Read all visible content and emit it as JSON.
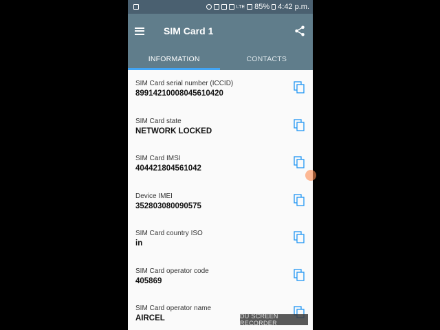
{
  "status_bar": {
    "battery": "85%",
    "time": "4:42 p.m.",
    "network_label": "LTE"
  },
  "toolbar": {
    "title": "SIM Card 1"
  },
  "tabs": [
    {
      "label": "INFORMATION",
      "active": true
    },
    {
      "label": "CONTACTS",
      "active": false
    }
  ],
  "items": [
    {
      "label": "SIM Card serial number (ICCID)",
      "value": "89914210008045610420"
    },
    {
      "label": "SIM Card state",
      "value": "NETWORK LOCKED"
    },
    {
      "label": "SIM Card IMSI",
      "value": "404421804561042"
    },
    {
      "label": "Device IMEI",
      "value": "352803080090575"
    },
    {
      "label": "SIM Card country ISO",
      "value": "in"
    },
    {
      "label": "SIM Card operator code",
      "value": "405869"
    },
    {
      "label": "SIM Card operator name",
      "value": "AIRCEL"
    }
  ],
  "watermark": "DU SCREEN RECORDER",
  "colors": {
    "toolbar": "#607d8b",
    "status_bar": "#4a6070",
    "tab_indicator": "#42a5f5",
    "copy_icon": "#2196f3"
  }
}
